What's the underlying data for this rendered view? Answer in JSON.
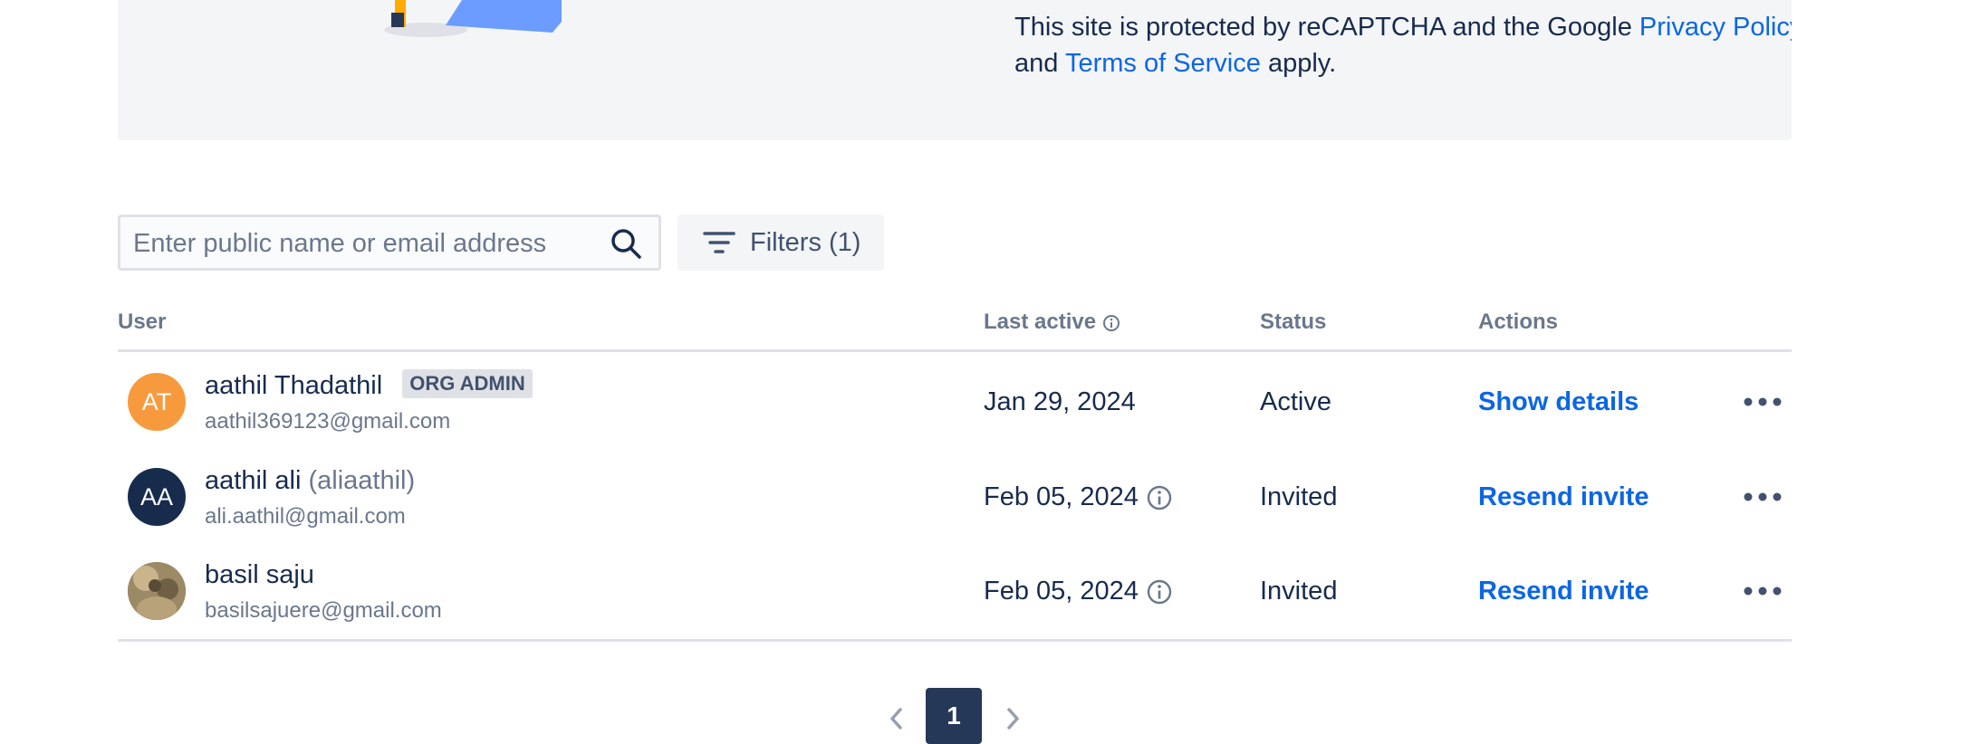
{
  "notice": {
    "text_before": "This site is protected by reCAPTCHA and the Google",
    "privacy_link": "Privacy Policy",
    "text_and": "and",
    "terms_link": "Terms of Service",
    "text_after": "apply."
  },
  "search": {
    "placeholder": "Enter public name or email address",
    "icon": "search-icon"
  },
  "filters": {
    "label": "Filters (1)",
    "icon": "filter-icon"
  },
  "table": {
    "columns": {
      "user": "User",
      "last_active": "Last active",
      "status": "Status",
      "actions": "Actions"
    },
    "rows": [
      {
        "initials": "AT",
        "avatar_color": "#f79a3e",
        "name": "aathil Thadathil",
        "handle": "",
        "badge": "ORG ADMIN",
        "email": "aathil369123@gmail.com",
        "last_active": "Jan 29, 2024",
        "status": "Active",
        "action": "Show details"
      },
      {
        "initials": "AA",
        "avatar_color": "#172b4d",
        "name": "aathil ali",
        "handle": "(aliaathil)",
        "badge": "",
        "email": "ali.aathil@gmail.com",
        "last_active": "Feb 05, 2024",
        "status": "Invited",
        "action": "Resend invite"
      },
      {
        "initials": "",
        "avatar_color": "#8a7a5c",
        "name": "basil saju",
        "handle": "",
        "badge": "",
        "email": "basilsajuere@gmail.com",
        "last_active": "Feb 05, 2024",
        "status": "Invited",
        "action": "Resend invite"
      }
    ]
  },
  "pagination": {
    "current": "1"
  },
  "colors": {
    "link": "#0c66e4",
    "text": "#172b4d",
    "muted": "#6b778c",
    "page_active": "#253858"
  }
}
